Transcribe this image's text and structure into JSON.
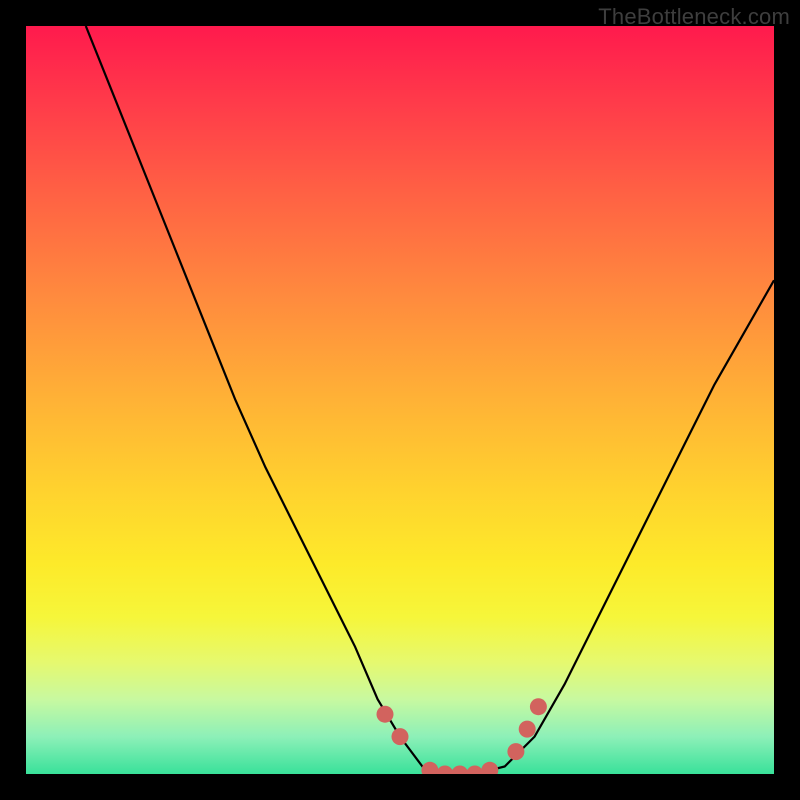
{
  "watermark": "TheBottleneck.com",
  "colors": {
    "frame": "#000000",
    "gradient_top": "#ff1a4d",
    "gradient_bottom": "#39e19a",
    "curve": "#000000",
    "marker": "#d2635e"
  },
  "chart_data": {
    "type": "line",
    "title": "",
    "xlabel": "",
    "ylabel": "",
    "xlim": [
      0,
      100
    ],
    "ylim": [
      0,
      100
    ],
    "series": [
      {
        "name": "bottleneck-curve",
        "x": [
          8,
          12,
          16,
          20,
          24,
          28,
          32,
          36,
          40,
          44,
          47,
          50,
          53,
          56,
          60,
          64,
          68,
          72,
          76,
          80,
          84,
          88,
          92,
          96,
          100
        ],
        "y": [
          100,
          90,
          80,
          70,
          60,
          50,
          41,
          33,
          25,
          17,
          10,
          5,
          1,
          0,
          0,
          1,
          5,
          12,
          20,
          28,
          36,
          44,
          52,
          59,
          66
        ]
      }
    ],
    "markers": [
      {
        "name": "tangent-ridge-left-a",
        "x": 48,
        "y": 8
      },
      {
        "name": "tangent-ridge-left-b",
        "x": 50,
        "y": 5
      },
      {
        "name": "plateau-a",
        "x": 54,
        "y": 0.5
      },
      {
        "name": "plateau-b",
        "x": 56,
        "y": 0
      },
      {
        "name": "plateau-c",
        "x": 58,
        "y": 0
      },
      {
        "name": "plateau-d",
        "x": 60,
        "y": 0
      },
      {
        "name": "plateau-e",
        "x": 62,
        "y": 0.5
      },
      {
        "name": "tangent-ridge-right-a",
        "x": 65.5,
        "y": 3
      },
      {
        "name": "tangent-ridge-right-b",
        "x": 67,
        "y": 6
      },
      {
        "name": "tangent-ridge-right-c",
        "x": 68.5,
        "y": 9
      }
    ]
  }
}
